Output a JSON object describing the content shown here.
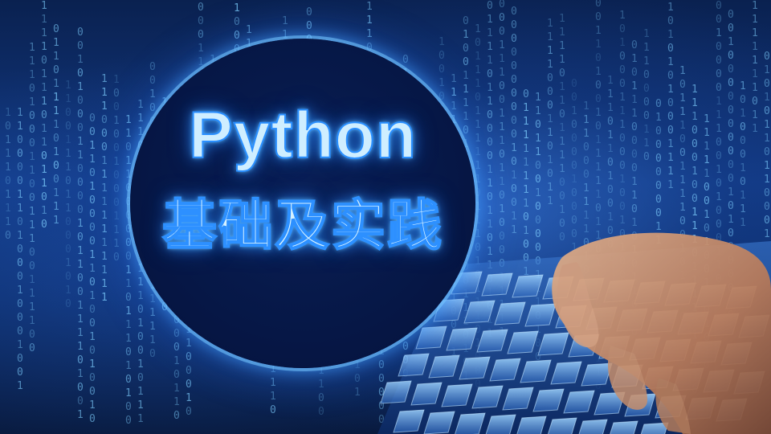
{
  "cover": {
    "title": "Python",
    "subtitle": "基础及实践"
  },
  "background": {
    "motif": "binary code rain over keyboard with typing hand",
    "glyphs": "01",
    "colors": {
      "deep_blue": "#07152e",
      "mid_blue": "#123a84",
      "code_cyan": "#7fd0ff",
      "badge_fill": "#061746",
      "glow": "#2a8fff",
      "hand": "#c98e6a"
    }
  }
}
